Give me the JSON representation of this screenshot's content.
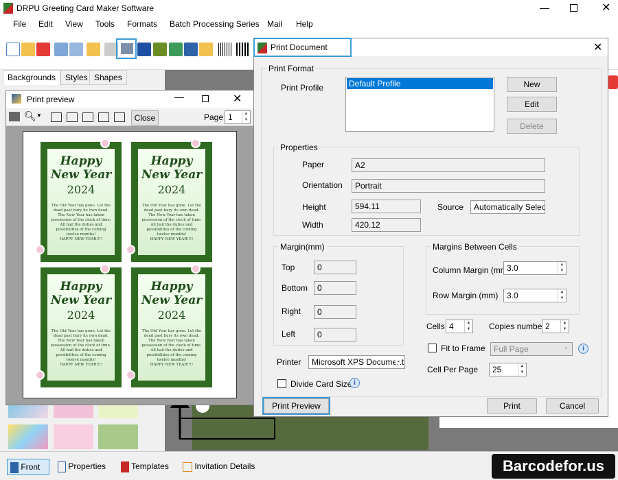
{
  "app": {
    "title": "DRPU Greeting Card Maker Software"
  },
  "menu": [
    "File",
    "Edit",
    "View",
    "Tools",
    "Formats",
    "Batch Processing Series",
    "Mail",
    "Help"
  ],
  "left_tabs": [
    "Backgrounds",
    "Styles",
    "Shapes"
  ],
  "bottom_tabs": [
    "Front",
    "Properties",
    "Templates",
    "Invitation Details"
  ],
  "brand": "Barcodefor.us",
  "preview": {
    "title": "Print preview",
    "close_label": "Close",
    "page_label": "Page",
    "page_value": "1",
    "card": {
      "line1": "Happy",
      "line2": "New Year",
      "year": "2024",
      "message": "The Old Year has gone. Let the dead past bury its own dead. The New Year has taken possession of the clock of time. All hail the duties and possibilities of the coming twelve months!",
      "closing": "HAPPY NEW YEAR!!!!"
    }
  },
  "dialog": {
    "title": "Print Document",
    "print_format_label": "Print Format",
    "print_profile_label": "Print Profile",
    "profile_selected": "Default Profile",
    "new_label": "New",
    "edit_label": "Edit",
    "delete_label": "Delete",
    "properties_label": "Properties",
    "paper_label": "Paper",
    "paper_value": "A2",
    "orientation_label": "Orientation",
    "orientation_value": "Portrait",
    "height_label": "Height",
    "height_value": "594.11",
    "source_label": "Source",
    "source_value": "Automatically Selec",
    "width_label": "Width",
    "width_value": "420.12",
    "margin_label": "Margin(mm)",
    "top_label": "Top",
    "top_value": "0",
    "bottom_label": "Bottom",
    "bottom_value": "0",
    "right_label": "Right",
    "right_value": "0",
    "left_label": "Left",
    "left_value": "0",
    "between_cells_label": "Margins Between Cells",
    "column_margin_label": "Column Margin (mm)",
    "column_margin_value": "3.0",
    "row_margin_label": "Row Margin (mm)",
    "row_margin_value": "3.0",
    "cells_label": "Cells",
    "cells_value": "4",
    "copies_label": "Copies number",
    "copies_value": "2",
    "fit_to_frame_label": "Fit to Frame",
    "fit_select_value": "Full Page",
    "cell_per_page_label": "Cell Per Page",
    "cell_per_page_value": "25",
    "printer_label": "Printer",
    "printer_value": "Microsoft XPS Document",
    "divide_card_label": "Divide Card Size",
    "print_preview_label": "Print Preview",
    "print_label": "Print",
    "cancel_label": "Cancel"
  },
  "colors": {
    "accent": "#3c9ad6",
    "selection": "#0078d7",
    "card_green": "#2f6b21"
  }
}
